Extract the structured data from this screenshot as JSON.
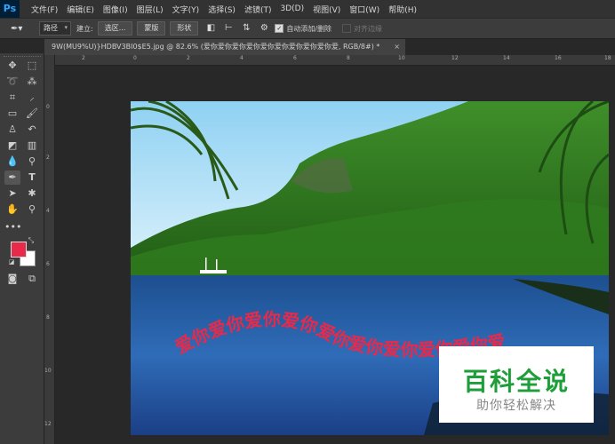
{
  "app": {
    "logo": "Ps"
  },
  "menu": [
    "文件(F)",
    "编辑(E)",
    "图像(I)",
    "图层(L)",
    "文字(Y)",
    "选择(S)",
    "滤镜(T)",
    "3D(D)",
    "视图(V)",
    "窗口(W)",
    "帮助(H)"
  ],
  "options": {
    "mode_select": "路径",
    "make_label": "建立:",
    "selection_btn": "选区...",
    "mask_btn": "蒙版",
    "shape_btn": "形状",
    "auto_add_delete": "自动添加/删除",
    "align_edges": "对齐边缘"
  },
  "document": {
    "tab_title": "9W(MU9%U)}HDBV3BI0$E5.jpg @ 82.6% (爱你爱你爱你爱你爱你爱你爱你爱你爱你爱, RGB/8#) *",
    "close_glyph": "×"
  },
  "ruler": {
    "top": [
      "2",
      "0",
      "2",
      "4",
      "6",
      "8",
      "10",
      "12",
      "14",
      "16",
      "18"
    ],
    "left": [
      "0",
      "2",
      "4",
      "6",
      "8",
      "10",
      "12"
    ]
  },
  "path_text": "爱你爱你爱你爱你爱你爱你爱你爱你爱你爱",
  "colors": {
    "foreground": "#e8294a",
    "background": "#ffffff",
    "text": "#e8294a"
  },
  "watermark": {
    "title": "百科全说",
    "subtitle": "助你轻松解决"
  },
  "icons": [
    "move-icon",
    "marquee-icon",
    "lasso-icon",
    "quick-select-icon",
    "crop-icon",
    "eyedropper-icon",
    "frame-icon",
    "brush-icon",
    "stamp-icon",
    "history-brush-icon",
    "eraser-icon",
    "gradient-icon",
    "blur-icon",
    "dodge-icon",
    "pen-icon",
    "type-icon",
    "path-select-icon",
    "custom-shape-icon",
    "hand-icon",
    "zoom-icon",
    "more-icon",
    "quick-mask-icon",
    "screen-mode-icon"
  ]
}
